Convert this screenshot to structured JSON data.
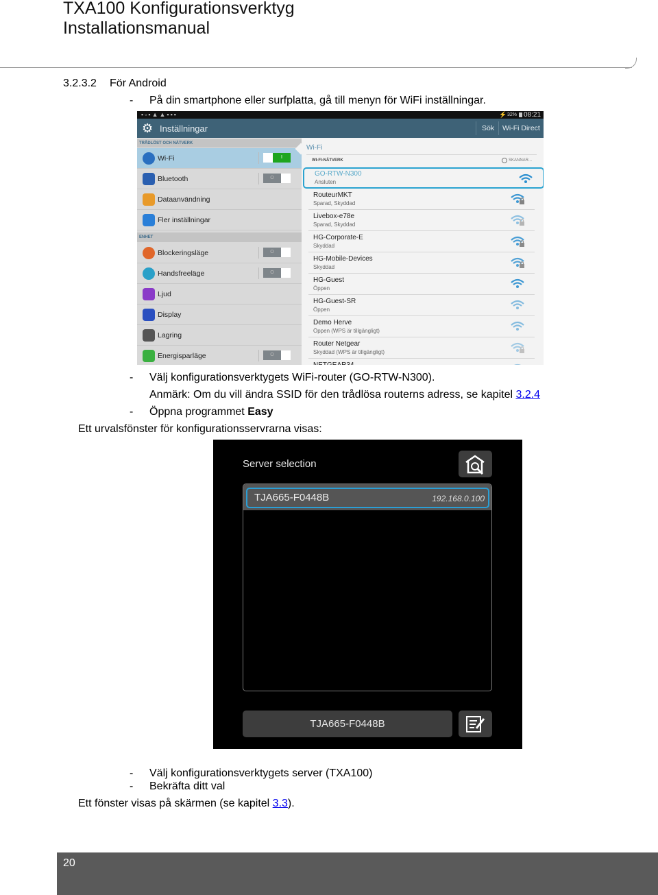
{
  "header": {
    "title_line1": "TXA100 Konfigurationsverktyg",
    "title_line2": "Installationsmanual"
  },
  "section": {
    "number": "3.2.3.2",
    "title": "För Android"
  },
  "step1": {
    "bullet": "-",
    "text": "På din smartphone eller surfplatta, gå till menyn för WiFi inställningar."
  },
  "android": {
    "status_time": "08:21",
    "battery": "32%",
    "app_title": "Inställningar",
    "actions": [
      "Sök",
      "Wi-Fi Direct"
    ],
    "section_wireless": "TRÅDLÖST OCH NÄTVERK",
    "section_device": "ENHET",
    "settings": [
      {
        "label": "Wi-Fi",
        "icon": "wifi-icon",
        "color": "#2a6fc0",
        "toggle": "on",
        "selected": true
      },
      {
        "label": "Bluetooth",
        "icon": "bluetooth-icon",
        "color": "#2a5fb0",
        "toggle": "off"
      },
      {
        "label": "Dataanvändning",
        "icon": "data-usage-icon",
        "color": "#e89a2a"
      },
      {
        "label": "Fler inställningar",
        "icon": "more-icon",
        "color": "#2a7fd8"
      },
      {
        "label": "Blockeringsläge",
        "icon": "block-icon",
        "color": "#e0662a",
        "toggle": "off"
      },
      {
        "label": "Handsfreeläge",
        "icon": "handsfree-icon",
        "color": "#2aa0c8",
        "toggle": "off"
      },
      {
        "label": "Ljud",
        "icon": "sound-icon",
        "color": "#8a3ac8"
      },
      {
        "label": "Display",
        "icon": "display-icon",
        "color": "#2a4fc0"
      },
      {
        "label": "Lagring",
        "icon": "storage-icon",
        "color": "#555555"
      },
      {
        "label": "Energisparläge",
        "icon": "battery-icon",
        "color": "#3ab040",
        "toggle": "off"
      }
    ],
    "toggle_on_glyph": "I",
    "toggle_off_glyph": "O",
    "wifi_heading": "Wi-Fi",
    "networks_heading": "WI-FI-NÄTVERK",
    "scanning": "SKANNAR...",
    "networks": [
      {
        "name": "GO-RTW-N300",
        "status": "Ansluten",
        "locked": false,
        "selected": true
      },
      {
        "name": "RouteurMKT",
        "status": "Sparad, Skyddad",
        "locked": true
      },
      {
        "name": "Livebox-e78e",
        "status": "Sparad, Skyddad",
        "locked": true
      },
      {
        "name": "HG-Corporate-E",
        "status": "Skyddad",
        "locked": true
      },
      {
        "name": "HG-Mobile-Devices",
        "status": "Skyddad",
        "locked": true
      },
      {
        "name": "HG-Guest",
        "status": "Öppen",
        "locked": false
      },
      {
        "name": "HG-Guest-SR",
        "status": "Öppen",
        "locked": false
      },
      {
        "name": "Demo Herve",
        "status": "Öppen (WPS är tillgängligt)",
        "locked": false
      },
      {
        "name": "Router Netgear",
        "status": "Skyddad (WPS är tillgängligt)",
        "locked": true
      },
      {
        "name": "NETGEAR34",
        "status": "",
        "locked": false
      }
    ],
    "accent": "#2aa3d0"
  },
  "step2": {
    "bullet": "-",
    "text": "Välj konfigurationsverktygets WiFi-router (GO-RTW-N300)."
  },
  "note": {
    "text": "Anmärk: Om du vill ändra SSID för den trådlösa routerns adress, se kapitel ",
    "link": "3.2.4"
  },
  "step3": {
    "bullet": "-",
    "text": "Öppna programmet ",
    "bold": "Easy"
  },
  "para1": "Ett urvalsfönster för konfigurationsservrarna visas:",
  "server": {
    "title": "Server selection",
    "items": [
      {
        "name": "TJA665-F0448B",
        "ip": "192.168.0.100"
      }
    ],
    "selected_name": "TJA665-F0448B",
    "accent": "#2a9fd6"
  },
  "step4": {
    "bullet": "-",
    "text": "Välj konfigurationsverktygets server (TXA100)"
  },
  "step5": {
    "bullet": "-",
    "text": "Bekräfta ditt val"
  },
  "para2": {
    "text": "Ett fönster visas på skärmen (se kapitel ",
    "link": "3.3",
    "after": ")."
  },
  "footer": {
    "page_number": "20"
  }
}
